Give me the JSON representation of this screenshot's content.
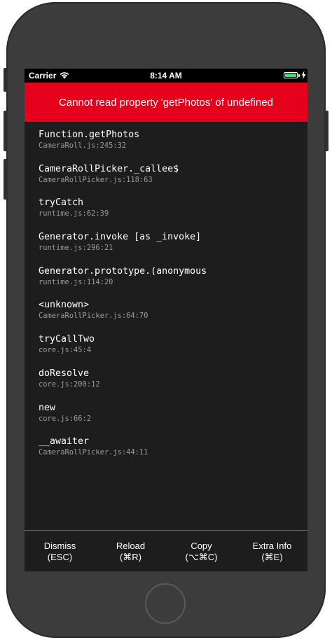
{
  "status_bar": {
    "carrier": "Carrier",
    "time": "8:14 AM",
    "battery_color": "#4cd964"
  },
  "error": {
    "message": "Cannot read property 'getPhotos' of undefined",
    "background_color": "#e5001c"
  },
  "stack_frames": [
    {
      "method": "Function.getPhotos",
      "location": "CameraRoll.js:245:32"
    },
    {
      "method": "CameraRollPicker._callee$",
      "location": "CameraRollPicker.js:118:63"
    },
    {
      "method": "tryCatch",
      "location": "runtime.js:62:39"
    },
    {
      "method": "Generator.invoke [as _invoke]",
      "location": "runtime.js:296:21"
    },
    {
      "method": "Generator.prototype.(anonymous",
      "location": "runtime.js:114:20"
    },
    {
      "method": "<unknown>",
      "location": "CameraRollPicker.js:64:70"
    },
    {
      "method": "tryCallTwo",
      "location": "core.js:45:4"
    },
    {
      "method": "doResolve",
      "location": "core.js:200:12"
    },
    {
      "method": "new",
      "location": "core.js:66:2"
    },
    {
      "method": "__awaiter",
      "location": "CameraRollPicker.js:44:11"
    }
  ],
  "toolbar": {
    "dismiss": {
      "label": "Dismiss",
      "shortcut": "(ESC)"
    },
    "reload": {
      "label": "Reload",
      "shortcut": "(⌘R)"
    },
    "copy": {
      "label": "Copy",
      "shortcut": "(⌥⌘C)"
    },
    "extra_info": {
      "label": "Extra Info",
      "shortcut": "(⌘E)"
    }
  },
  "icons": {
    "wifi": "wifi-icon",
    "battery": "battery-icon",
    "charging": "charging-bolt-icon",
    "home": "home-button"
  }
}
